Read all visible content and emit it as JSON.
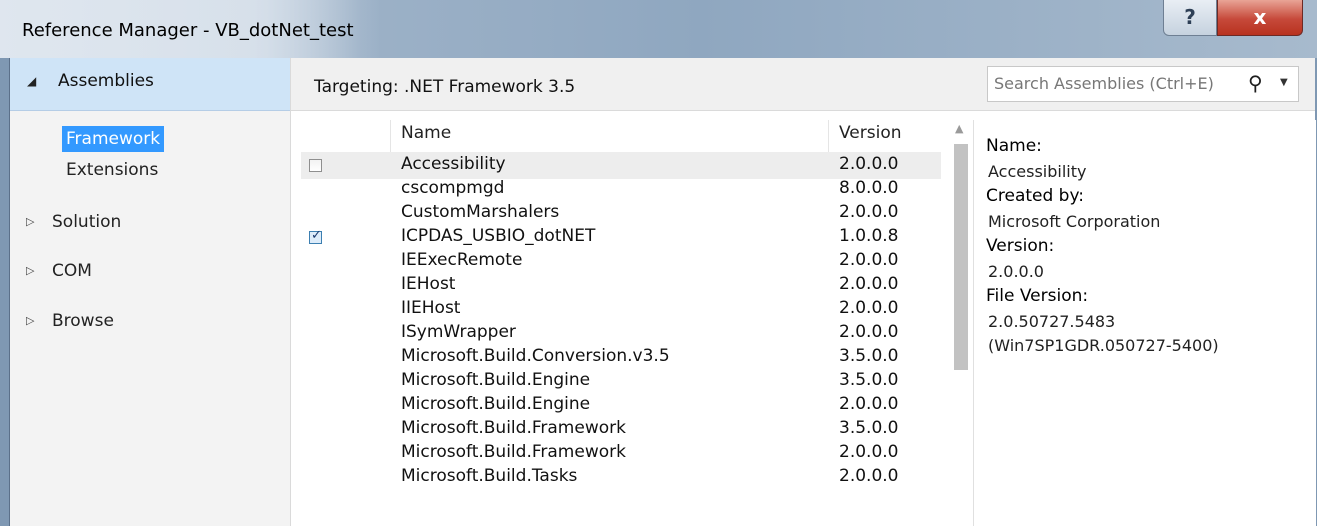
{
  "window": {
    "title": "Reference Manager - VB_dotNet_test",
    "help_glyph": "?",
    "close_glyph": "x"
  },
  "nav": {
    "header": {
      "arrow": "◢",
      "label": "Assemblies"
    },
    "sub_items": [
      {
        "label": "Framework",
        "selected": true
      },
      {
        "label": "Extensions",
        "selected": false
      }
    ],
    "items": [
      {
        "arrow": "▷",
        "label": "Solution"
      },
      {
        "arrow": "▷",
        "label": "COM"
      },
      {
        "arrow": "▷",
        "label": "Browse"
      }
    ]
  },
  "toolbar": {
    "targeting": "Targeting: .NET Framework 3.5",
    "search_placeholder": "Search Assemblies (Ctrl+E)",
    "search_icon": "search-icon"
  },
  "table": {
    "columns": [
      "Name",
      "Version"
    ],
    "rows": [
      {
        "name": "Accessibility",
        "version": "2.0.0.0",
        "checkbox": true,
        "checked": false,
        "highlighted": true
      },
      {
        "name": "cscompmgd",
        "version": "8.0.0.0",
        "checkbox": false,
        "checked": false
      },
      {
        "name": "CustomMarshalers",
        "version": "2.0.0.0",
        "checkbox": false,
        "checked": false
      },
      {
        "name": "ICPDAS_USBIO_dotNET",
        "version": "1.0.0.8",
        "checkbox": true,
        "checked": true
      },
      {
        "name": "IEExecRemote",
        "version": "2.0.0.0",
        "checkbox": false,
        "checked": false
      },
      {
        "name": "IEHost",
        "version": "2.0.0.0",
        "checkbox": false,
        "checked": false
      },
      {
        "name": "IIEHost",
        "version": "2.0.0.0",
        "checkbox": false,
        "checked": false
      },
      {
        "name": "ISymWrapper",
        "version": "2.0.0.0",
        "checkbox": false,
        "checked": false
      },
      {
        "name": "Microsoft.Build.Conversion.v3.5",
        "version": "3.5.0.0",
        "checkbox": false,
        "checked": false
      },
      {
        "name": "Microsoft.Build.Engine",
        "version": "3.5.0.0",
        "checkbox": false,
        "checked": false
      },
      {
        "name": "Microsoft.Build.Engine",
        "version": "2.0.0.0",
        "checkbox": false,
        "checked": false
      },
      {
        "name": "Microsoft.Build.Framework",
        "version": "3.5.0.0",
        "checkbox": false,
        "checked": false
      },
      {
        "name": "Microsoft.Build.Framework",
        "version": "2.0.0.0",
        "checkbox": false,
        "checked": false
      },
      {
        "name": "Microsoft.Build.Tasks",
        "version": "2.0.0.0",
        "checkbox": false,
        "checked": false
      }
    ]
  },
  "details": {
    "name_label": "Name:",
    "name_value": "Accessibility",
    "created_label": "Created by:",
    "created_value": "Microsoft Corporation",
    "version_label": "Version:",
    "version_value": "2.0.0.0",
    "file_version_label": "File Version:",
    "file_version_value": "2.0.50727.5483",
    "file_version_extra": "(Win7SP1GDR.050727-5400)"
  },
  "colors": {
    "selection": "#3399ff",
    "nav_header": "#cfe4f7",
    "close_button": "#c6493a"
  }
}
